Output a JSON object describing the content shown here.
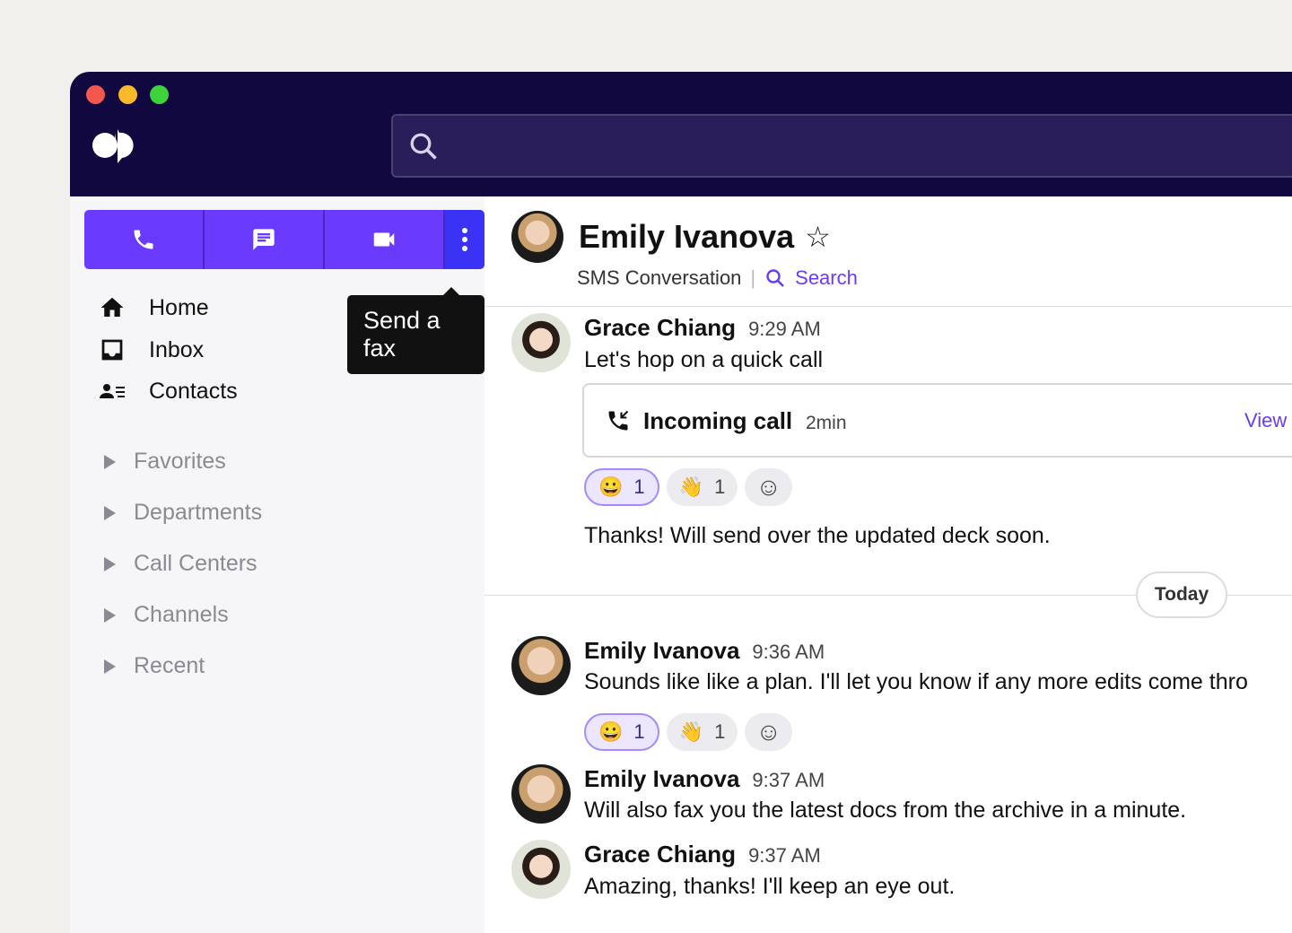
{
  "window": {
    "controls": [
      "close",
      "minimize",
      "maximize"
    ]
  },
  "header": {
    "logo": "dialpad-logo",
    "search_icon": "search-icon"
  },
  "sidebar": {
    "actions": [
      {
        "icon": "phone-icon"
      },
      {
        "icon": "message-icon"
      },
      {
        "icon": "video-icon"
      },
      {
        "icon": "more-vertical-icon"
      }
    ],
    "tooltip": "Send a fax",
    "nav": [
      {
        "label": "Home",
        "icon": "home-icon"
      },
      {
        "label": "Inbox",
        "icon": "inbox-icon"
      },
      {
        "label": "Contacts",
        "icon": "contacts-icon"
      }
    ],
    "groups": [
      {
        "label": "Favorites"
      },
      {
        "label": "Departments"
      },
      {
        "label": "Call Centers"
      },
      {
        "label": "Channels"
      },
      {
        "label": "Recent"
      }
    ]
  },
  "conversation": {
    "title": "Emily Ivanova",
    "subtitle": "SMS Conversation",
    "separator": "|",
    "search_label": "Search",
    "accent": "#6a3bff",
    "messages": [
      {
        "sender": "Grace Chiang",
        "time": "9:29 AM",
        "text": "Let's hop on a quick call"
      },
      {
        "call_label": "Incoming call",
        "call_duration": "2min",
        "view_label": "View"
      },
      {
        "text": "Thanks! Will send over the updated deck soon."
      },
      {
        "sender": "Emily Ivanova",
        "time": "9:36 AM",
        "text": "Sounds like like a plan. I'll let you know if any more edits come thro"
      },
      {
        "sender": "Emily Ivanova",
        "time": "9:37 AM",
        "text": "Will also fax you the latest docs from the archive in a minute."
      },
      {
        "sender": "Grace Chiang",
        "time": "9:37 AM",
        "text": "Amazing, thanks! I'll keep an eye out."
      }
    ],
    "reactions": [
      {
        "emoji": "😀",
        "count": "1"
      },
      {
        "emoji": "👋",
        "count": "1"
      }
    ],
    "date_divider": "Today"
  }
}
